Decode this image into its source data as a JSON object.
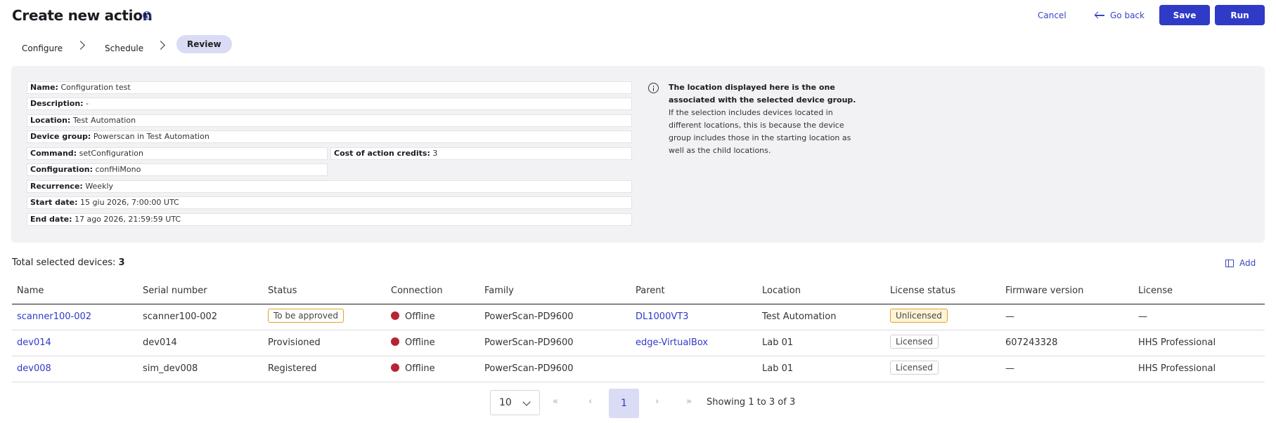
{
  "header": {
    "title": "Create new action",
    "cancel_label": "Cancel",
    "go_back_label": "Go back",
    "save_label": "Save",
    "run_label": "Run"
  },
  "steps": [
    "Configure",
    "Schedule",
    "Review"
  ],
  "summary": {
    "name": {
      "label": "Name:",
      "value": "Configuration test"
    },
    "description": {
      "label": "Description:",
      "value": "-"
    },
    "location": {
      "label": "Location:",
      "value": "Test Automation"
    },
    "device_group": {
      "label": "Device group:",
      "value": "Powerscan in Test Automation"
    },
    "command": {
      "label": "Command:",
      "value": "setConfiguration"
    },
    "cost": {
      "label": "Cost of action credits:",
      "value": "3"
    },
    "configuration": {
      "label": "Configuration:",
      "value": "confHiMono"
    },
    "recurrence": {
      "label": "Recurrence:",
      "value": "Weekly"
    },
    "start_date": {
      "label": "Start date:",
      "value": "15 giu 2026, 7:00:00 UTC"
    },
    "end_date": {
      "label": "End date:",
      "value": "17 ago 2026, 21:59:59 UTC"
    }
  },
  "note": {
    "bold": "The location displayed here is the one associated with the selected device group.",
    "text": "If the selection includes devices located in different locations, this is because the device group includes those in the starting location as well as the child locations."
  },
  "devices": {
    "total_label": "Total selected devices:",
    "total_value": "3",
    "add_label": "Add",
    "columns": [
      "Name",
      "Serial number",
      "Status",
      "Connection",
      "Family",
      "Parent",
      "Location",
      "License status",
      "Firmware version",
      "License"
    ],
    "rows": [
      {
        "name": "scanner100-002",
        "serial": "scanner100-002",
        "status": "To be approved",
        "connection": "Offline",
        "family": "PowerScan-PD9600",
        "parent": "DL1000VT3",
        "location": "Test Automation",
        "license_status": "Unlicensed",
        "firmware": "—",
        "license": "—"
      },
      {
        "name": "dev014",
        "serial": "dev014",
        "status": "Provisioned",
        "connection": "Offline",
        "family": "PowerScan-PD9600",
        "parent": "edge-VirtualBox",
        "location": "Lab 01",
        "license_status": "Licensed",
        "firmware": "607243328",
        "license": "HHS Professional"
      },
      {
        "name": "dev008",
        "serial": "sim_dev008",
        "status": "Registered",
        "connection": "Offline",
        "family": "PowerScan-PD9600",
        "parent": "",
        "location": "Lab 01",
        "license_status": "Licensed",
        "firmware": "—",
        "license": "HHS Professional"
      }
    ]
  },
  "pagination": {
    "page_size": "10",
    "first": "«",
    "prev": "‹",
    "current": "1",
    "next": "›",
    "last": "»",
    "showing": "Showing 1 to 3 of 3"
  }
}
